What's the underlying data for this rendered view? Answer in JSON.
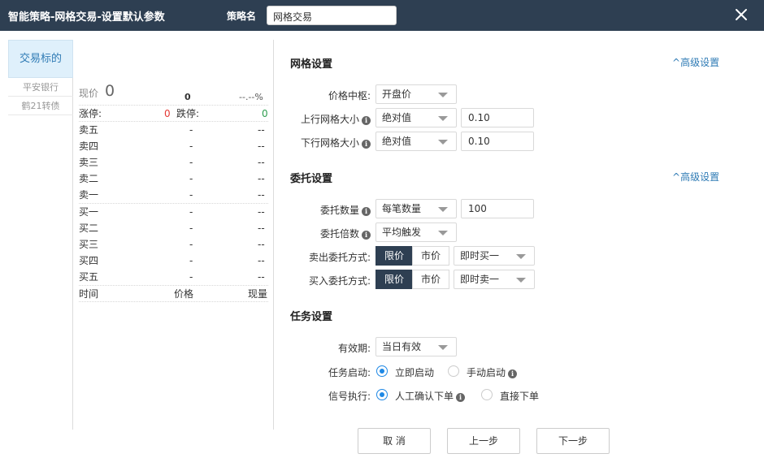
{
  "title": "智能策略-网格交易-设置默认参数",
  "strategy_name_label": "策略名",
  "strategy_name_value": "网格交易",
  "nav": {
    "active": "交易标的",
    "items": [
      "平安银行",
      "鹤21转债"
    ]
  },
  "quote": {
    "price_label": "现价",
    "price_value": "0",
    "change_value": "0",
    "change_pct": "--.--%",
    "limit_up_label": "涨停:",
    "limit_up_value": "0",
    "limit_down_label": "跌停:",
    "limit_down_value": "0",
    "asks": [
      {
        "label": "卖五",
        "price": "-",
        "volume": "--"
      },
      {
        "label": "卖四",
        "price": "-",
        "volume": "--"
      },
      {
        "label": "卖三",
        "price": "-",
        "volume": "--"
      },
      {
        "label": "卖二",
        "price": "-",
        "volume": "--"
      },
      {
        "label": "卖一",
        "price": "-",
        "volume": "--"
      }
    ],
    "bids": [
      {
        "label": "买一",
        "price": "-",
        "volume": "--"
      },
      {
        "label": "买二",
        "price": "-",
        "volume": "--"
      },
      {
        "label": "买三",
        "price": "-",
        "volume": "--"
      },
      {
        "label": "买四",
        "price": "-",
        "volume": "--"
      },
      {
        "label": "买五",
        "price": "-",
        "volume": "--"
      }
    ],
    "footer": {
      "time": "时间",
      "price": "价格",
      "volume": "现量"
    }
  },
  "grid_section": {
    "title": "网格设置",
    "advanced": "高级设置",
    "center_label": "价格中枢:",
    "center_value": "开盘价",
    "up_label": "上行网格大小",
    "up_type": "绝对值",
    "up_value": "0.10",
    "down_label": "下行网格大小",
    "down_type": "绝对值",
    "down_value": "0.10"
  },
  "order_section": {
    "title": "委托设置",
    "advanced": "高级设置",
    "qty_label": "委托数量",
    "qty_type": "每笔数量",
    "qty_value": "100",
    "mult_label": "委托倍数",
    "mult_value": "平均触发",
    "sell_label": "卖出委托方式:",
    "sell_limit": "限价",
    "sell_market": "市价",
    "sell_price": "即时买一",
    "buy_label": "买入委托方式:",
    "buy_limit": "限价",
    "buy_market": "市价",
    "buy_price": "即时卖一"
  },
  "task_section": {
    "title": "任务设置",
    "validity_label": "有效期:",
    "validity_value": "当日有效",
    "start_label": "任务启动:",
    "start_opt1": "立即启动",
    "start_opt2": "手动启动",
    "signal_label": "信号执行:",
    "signal_opt1": "人工确认下单",
    "signal_opt2": "直接下单"
  },
  "buttons": {
    "cancel": "取 消",
    "prev": "上一步",
    "next": "下一步"
  },
  "colors": {
    "titlebar": "#2e3f52",
    "accent": "#2f7bb5",
    "up": "#e53935",
    "down": "#2e9d4f"
  }
}
